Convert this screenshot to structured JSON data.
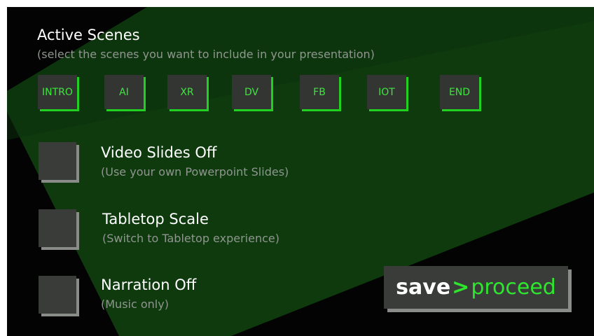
{
  "header": {
    "title": "Active Scenes",
    "subtitle": "(select the scenes you want to include in your presentation)"
  },
  "scenes": [
    {
      "label": "INTRO"
    },
    {
      "label": "AI"
    },
    {
      "label": "XR"
    },
    {
      "label": "DV"
    },
    {
      "label": "FB"
    },
    {
      "label": "IOT"
    },
    {
      "label": "END"
    }
  ],
  "options": [
    {
      "title": "Video Slides Off",
      "subtitle": "(Use your own Powerpoint Slides)"
    },
    {
      "title": "Tabletop Scale",
      "subtitle": "(Switch to Tabletop experience)"
    },
    {
      "title": "Narration Off",
      "subtitle": "(Music only)"
    }
  ],
  "save_button": {
    "save": "save",
    "arrow": ">",
    "proceed": "proceed"
  },
  "colors": {
    "background": "#020302",
    "band": "#0e3a0e",
    "accent": "#2ee62e"
  }
}
